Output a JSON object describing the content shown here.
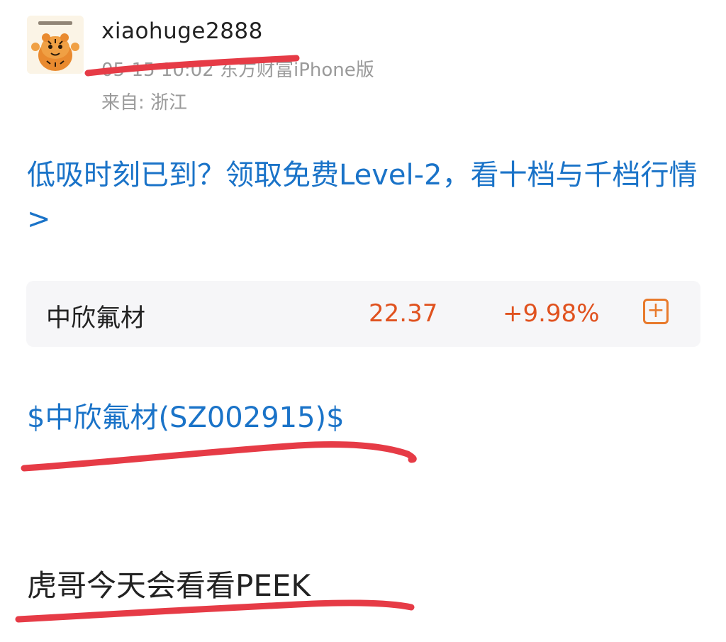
{
  "post": {
    "username": "xiaohuge2888",
    "meta": "05-15 10:02 东方财富iPhone版",
    "location": "来自: 浙江",
    "promo_link": "低吸时刻已到？领取免费Level-2，看十档与千档行情>",
    "stock_card": {
      "name": "中欣氟材",
      "price": "22.37",
      "change": "+9.98%",
      "add_symbol": "+"
    },
    "stock_link": "$中欣氟材(SZ002915)$",
    "body_text": "虎哥今天会看看PEEK"
  },
  "colors": {
    "link": "#1a73c8",
    "rise": "#e0521f",
    "annotation": "#e63b46",
    "muted_text": "#9a9a9a"
  },
  "icons": {
    "avatar": "tiger-avatar-icon",
    "add": "add-to-watchlist-icon"
  }
}
